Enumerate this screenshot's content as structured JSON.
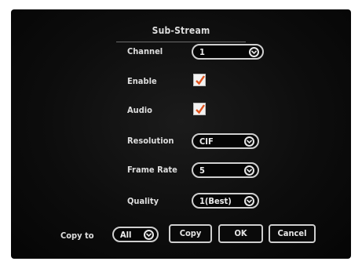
{
  "dialog": {
    "title": "Sub-Stream"
  },
  "fields": {
    "channel": {
      "label": "Channel",
      "value": "1"
    },
    "enable": {
      "label": "Enable",
      "checked": true
    },
    "audio": {
      "label": "Audio",
      "checked": true
    },
    "resolution": {
      "label": "Resolution",
      "value": "CIF"
    },
    "frame_rate": {
      "label": "Frame Rate",
      "value": "5"
    },
    "quality": {
      "label": "Quality",
      "value": "1(Best)"
    }
  },
  "footer": {
    "copy_to_label": "Copy to",
    "copy_to_value": "All",
    "copy_button": "Copy",
    "ok_button": "OK",
    "cancel_button": "Cancel"
  },
  "colors": {
    "background": "#0d0d0d",
    "checkmark": "#e0521c",
    "border": "#cfcfcf"
  }
}
